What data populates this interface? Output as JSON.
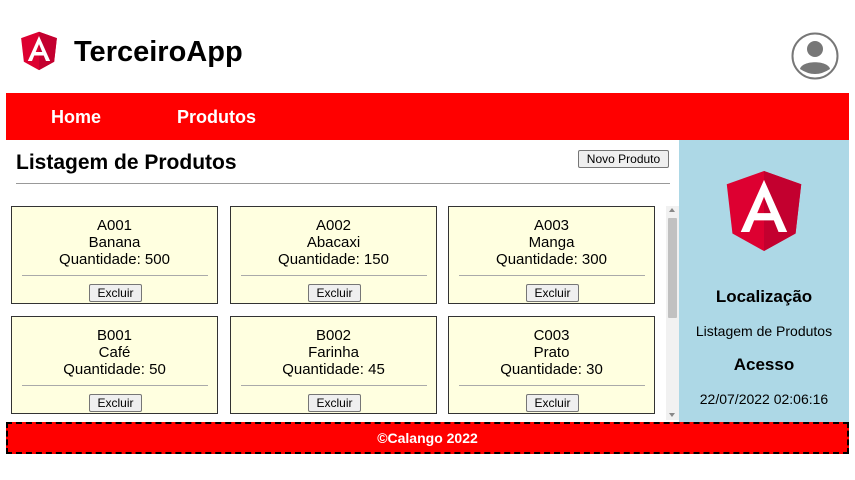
{
  "header": {
    "app_title": "TerceiroApp",
    "logo_icon": "angular-logo-icon",
    "avatar_icon": "user-avatar-icon"
  },
  "nav": {
    "items": [
      {
        "label": "Home"
      },
      {
        "label": "Produtos"
      }
    ]
  },
  "main": {
    "title": "Listagem de Produtos",
    "new_button_label": "Novo Produto",
    "delete_label": "Excluir",
    "products": [
      {
        "code": "A001",
        "name": "Banana",
        "quantity": "Quantidade: 500"
      },
      {
        "code": "A002",
        "name": "Abacaxi",
        "quantity": "Quantidade: 150"
      },
      {
        "code": "A003",
        "name": "Manga",
        "quantity": "Quantidade: 300"
      },
      {
        "code": "B001",
        "name": "Café",
        "quantity": "Quantidade: 50"
      },
      {
        "code": "B002",
        "name": "Farinha",
        "quantity": "Quantidade: 45"
      },
      {
        "code": "C003",
        "name": "Prato",
        "quantity": "Quantidade: 30"
      }
    ]
  },
  "side": {
    "location_heading": "Localização",
    "location_value": "Listagem de Produtos",
    "access_heading": "Acesso",
    "access_value": "22/07/2022 02:06:16"
  },
  "footer": {
    "text": "©Calango 2022"
  },
  "colors": {
    "brand_red": "#ff0000",
    "angular_red": "#dd0031",
    "card_bg": "#ffffe0",
    "sidebar_bg": "#add8e6"
  }
}
